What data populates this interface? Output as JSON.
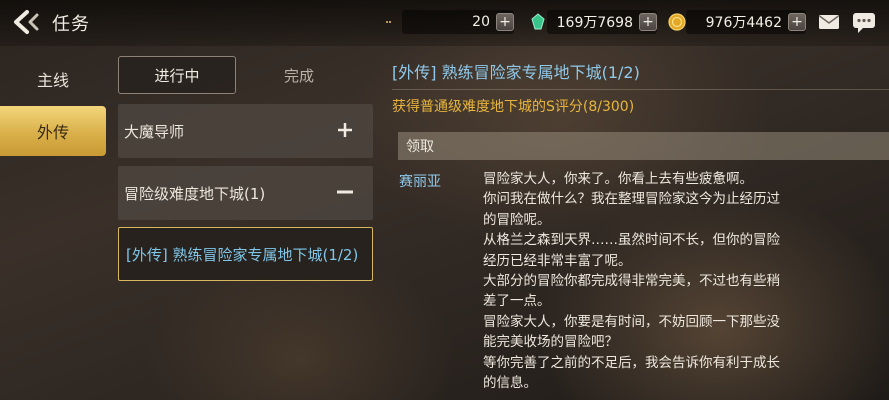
{
  "header": {
    "title": "任务",
    "currency_1": {
      "icon": "crescent-moon-icon",
      "value": "20"
    },
    "currency_2": {
      "icon": "green-crystal-icon",
      "value": "169万7698"
    },
    "currency_3": {
      "icon": "gold-coin-icon",
      "value": "976万4462"
    },
    "add_label": "+"
  },
  "sidebar": {
    "items": [
      {
        "label": "主线",
        "active": false
      },
      {
        "label": "外传",
        "active": true
      }
    ]
  },
  "subtabs": [
    {
      "label": "进行中",
      "active": true
    },
    {
      "label": "完成",
      "active": false
    }
  ],
  "quest_list": [
    {
      "label": "大魔导师",
      "state": "collapsed"
    },
    {
      "label": "冒险级难度地下城(1)",
      "state": "expanded"
    },
    {
      "label": "[外传] 熟练冒险家专属地下城(1/2)",
      "state": "selected"
    }
  ],
  "detail": {
    "title": "[外传] 熟练冒险家专属地下城(1/2)",
    "objective": "获得普通级难度地下城的S评分(8/300)",
    "reward_label": "领取",
    "speaker": "赛丽亚",
    "dialog_lines": [
      "冒险家大人，你来了。你看上去有些疲惫啊。",
      "你问我在做什么？我在整理冒险家这今为止经历过",
      "的冒险呢。",
      "从格兰之森到天界……虽然时间不长，但你的冒险",
      "经历已经非常丰富了呢。",
      "大部分的冒险你都完成得非常完美，不过也有些稍",
      "差了一点。",
      "冒险家大人，你要是有时间，不妨回顾一下那些没",
      "能完美收场的冒险吧？",
      "等你完善了之前的不足后，我会告诉你有利于成长",
      "的信息。"
    ]
  },
  "colors": {
    "accent_gold": "#d9b04a",
    "title_blue": "#8fc9ea",
    "objective_gold": "#e7b53c"
  }
}
